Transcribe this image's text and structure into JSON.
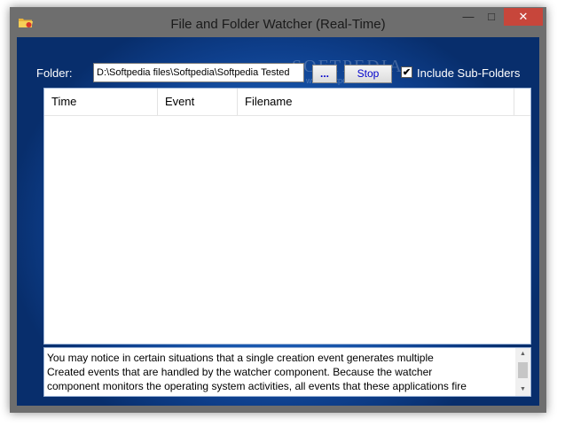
{
  "window": {
    "title": "File and Folder Watcher (Real-Time)",
    "minimize_glyph": "—",
    "maximize_glyph": "□",
    "close_glyph": "✕"
  },
  "folder": {
    "label": "Folder:",
    "path": "D:\\Softpedia files\\Softpedia\\Softpedia Tested"
  },
  "buttons": {
    "browse_label": "...",
    "stop_label": "Stop"
  },
  "include_subfolders": {
    "label": "Include Sub-Folders",
    "checked": true,
    "check_glyph": "✔"
  },
  "watermark": {
    "text": "SOFTPEDIA",
    "sub": "www.softpedia.com"
  },
  "events_table": {
    "columns": [
      "Time",
      "Event",
      "Filename"
    ],
    "rows": []
  },
  "note": {
    "lines": [
      "You may notice in certain situations that a single creation event generates multiple",
      "Created events that are handled by the watcher component. Because the watcher",
      "component monitors the operating system activities, all events that these applications fire"
    ]
  },
  "icons": {
    "app": "folder-icon",
    "scroll_up": "▲",
    "scroll_down": "▼"
  },
  "colors": {
    "background_blue": "#1e62bc",
    "close_red": "#c7463b",
    "button_text": "#0000cc"
  }
}
